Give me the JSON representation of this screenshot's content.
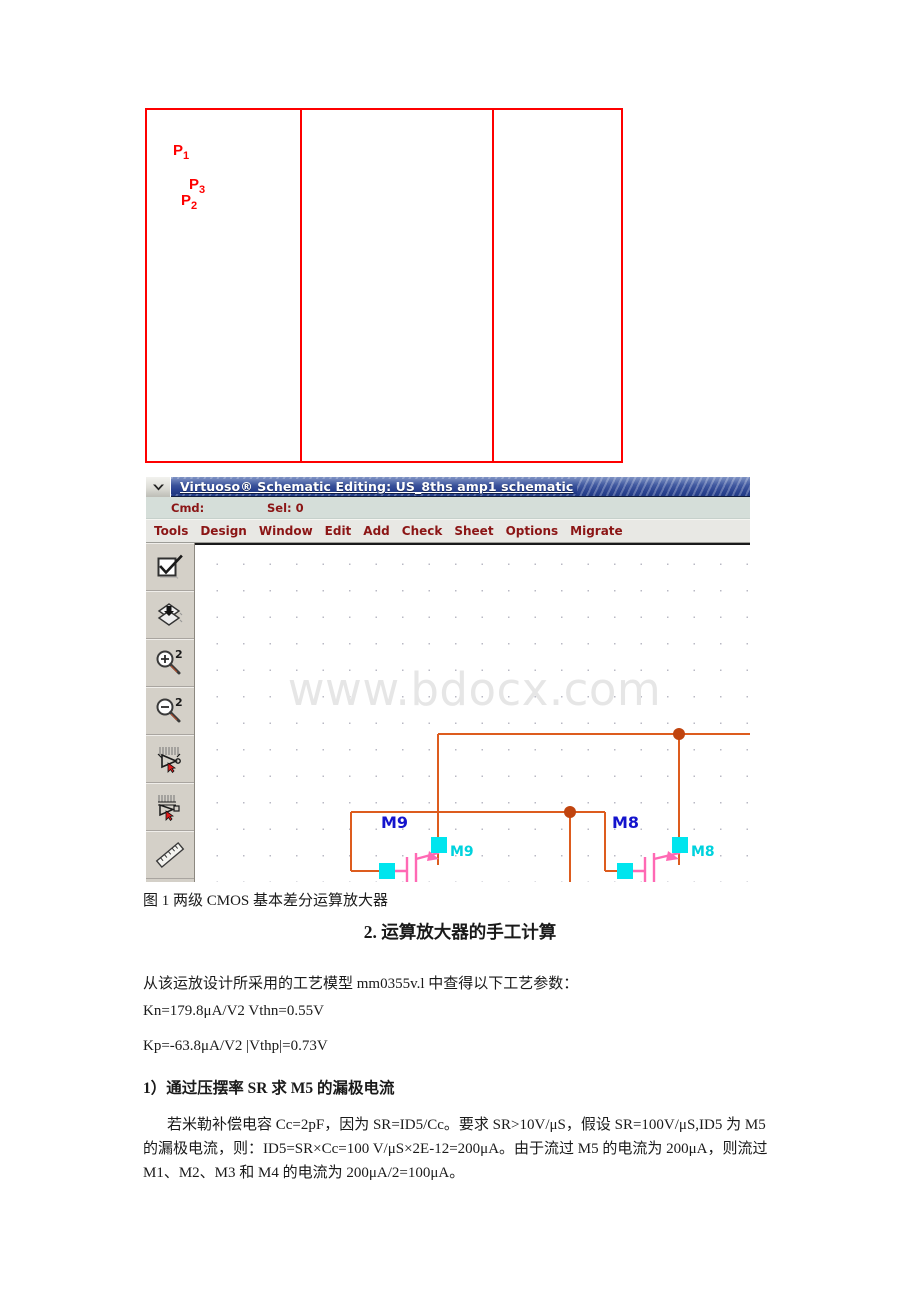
{
  "annotation_boxes": {
    "boxes": [
      {
        "id": "P1",
        "letter": "P",
        "sub": "1"
      },
      {
        "id": "P2",
        "letter": "P",
        "sub": "2"
      },
      {
        "id": "P3",
        "letter": "P",
        "sub": "3"
      }
    ],
    "color": "#fe0000"
  },
  "virtuoso": {
    "title": "Virtuoso® Schematic Editing: US_8ths amp1 schematic",
    "title_bar_color": "#2d4591",
    "status": {
      "cmd_label": "Cmd:",
      "sel_label": "Sel: 0"
    },
    "menubar": [
      {
        "label": "Tools"
      },
      {
        "label": "Design"
      },
      {
        "label": "Window"
      },
      {
        "label": "Edit"
      },
      {
        "label": "Add"
      },
      {
        "label": "Check"
      },
      {
        "label": "Sheet"
      },
      {
        "label": "Options"
      },
      {
        "label": "Migrate"
      }
    ],
    "menu_color": "#8b1515",
    "toolbar": [
      {
        "icon": "check-box-icon",
        "tooltip": "Check and Save"
      },
      {
        "icon": "save-to-disk-icon",
        "tooltip": "Save"
      },
      {
        "icon": "zoom-in-2x-icon",
        "tooltip": "Zoom In by 2",
        "badge": "2"
      },
      {
        "icon": "zoom-out-2x-icon",
        "tooltip": "Zoom Out by 2",
        "badge": "2"
      },
      {
        "icon": "select-device-icon",
        "tooltip": "Select Device"
      },
      {
        "icon": "select-net-icon",
        "tooltip": "Select Net"
      },
      {
        "icon": "ruler-icon",
        "tooltip": "Create Ruler"
      }
    ],
    "canvas": {
      "watermark": "www.bdocx.com",
      "wire_color": "#dd5c1e",
      "device_color": "#ff69b4",
      "pin_color": "#00e5ee",
      "label_color": "#1414cd",
      "instances": [
        {
          "name": "M9",
          "type": "nmos",
          "label": "M9",
          "instance_label": "M9"
        },
        {
          "name": "M8",
          "type": "nmos",
          "label": "M8",
          "instance_label": "M8"
        }
      ]
    }
  },
  "document": {
    "figure_caption": "图 1 两级 CMOS 基本差分运算放大器",
    "section_heading": "2. 运算放大器的手工计算",
    "paragraph_process": "从该运放设计所采用的工艺模型 mm0355v.l 中查得以下工艺参数：",
    "line_kn": "Kn=179.8μA/V2 Vthn=0.55V",
    "line_kp": "Kp=-63.8μA/V2 |Vthp|=0.73V",
    "subheading_1": "1）通过压摆率 SR 求 M5 的漏极电流",
    "paragraph_calc": "若米勒补偿电容 Cc=2pF，因为 SR=ID5/Cc。要求 SR>10V/μS，假设 SR=100V/μS,ID5 为 M5 的漏极电流，则：ID5=SR×Cc=100 V/μS×2E-12=200μA。由于流过 M5 的电流为 200μA，则流过 M1、M2、M3 和 M4 的电流为 200μA/2=100μA。"
  }
}
